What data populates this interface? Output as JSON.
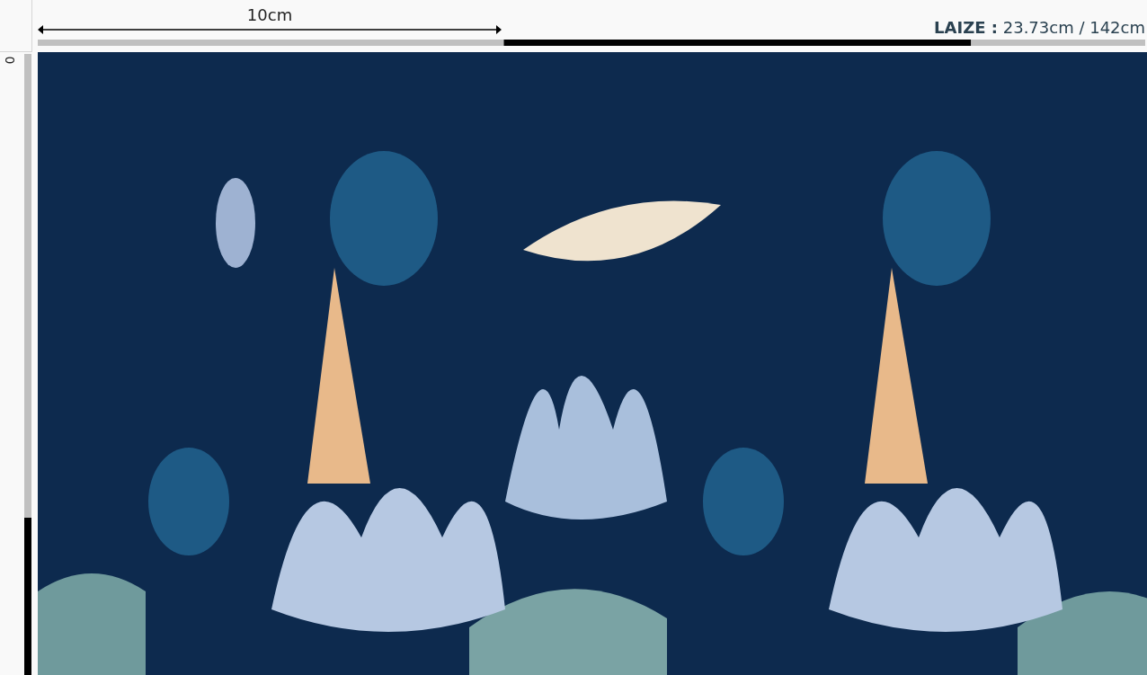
{
  "top_ruler": {
    "measure_label": "10cm",
    "width_label": "LAIZE :",
    "width_value": "23.73cm / 142cm"
  },
  "left_ruler": {
    "origin_label": "0"
  }
}
